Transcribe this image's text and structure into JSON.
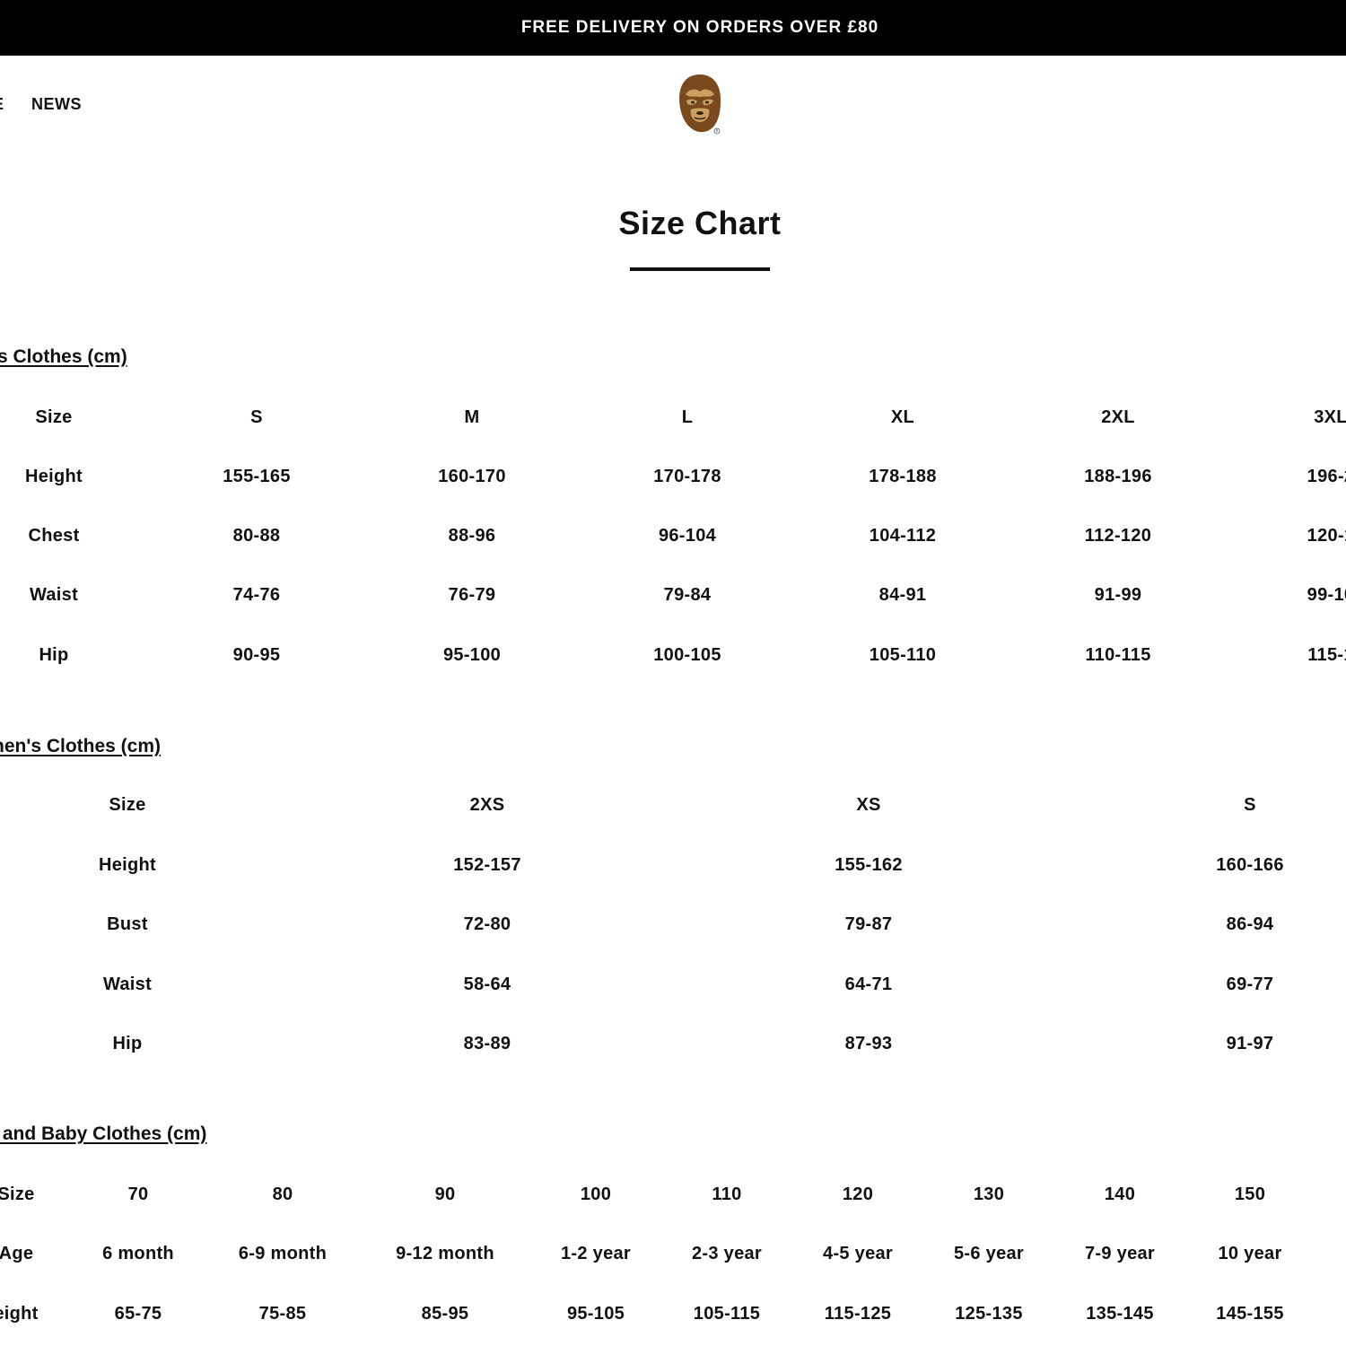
{
  "promo": {
    "text": "FREE DELIVERY ON ORDERS OVER £80"
  },
  "nav": {
    "partial_label": "E",
    "news_label": "NEWS"
  },
  "logo": {
    "name": "ape-head-logo",
    "color": "#7a4a1e"
  },
  "page": {
    "title": "Size Chart"
  },
  "tables": [
    {
      "title": "'s Clothes (cm)",
      "rows": [
        [
          "Size",
          "S",
          "M",
          "L",
          "XL",
          "2XL",
          "3XL"
        ],
        [
          "Height",
          "155-165",
          "160-170",
          "170-178",
          "178-188",
          "188-196",
          "196-2"
        ],
        [
          "Chest",
          "80-88",
          "88-96",
          "96-104",
          "104-112",
          "112-120",
          "120-1"
        ],
        [
          "Waist",
          "74-76",
          "76-79",
          "79-84",
          "84-91",
          "91-99",
          "99-10"
        ],
        [
          "Hip",
          "90-95",
          "95-100",
          "100-105",
          "105-110",
          "110-115",
          "115-1"
        ]
      ]
    },
    {
      "title": "nen's Clothes (cm)",
      "rows": [
        [
          "Size",
          "2XS",
          "XS",
          "S"
        ],
        [
          "Height",
          "152-157",
          "155-162",
          "160-166"
        ],
        [
          "Bust",
          "72-80",
          "79-87",
          "86-94"
        ],
        [
          "Waist",
          "58-64",
          "64-71",
          "69-77"
        ],
        [
          "Hip",
          "83-89",
          "87-93",
          "91-97"
        ]
      ]
    },
    {
      "title": "' and Baby Clothes (cm)",
      "rows": [
        [
          "Size",
          "70",
          "80",
          "90",
          "100",
          "110",
          "120",
          "130",
          "140",
          "150"
        ],
        [
          "Age",
          "6 month",
          "6-9 month",
          "9-12 month",
          "1-2 year",
          "2-3 year",
          "4-5 year",
          "5-6 year",
          "7-9 year",
          "10 year"
        ],
        [
          "eight",
          "65-75",
          "75-85",
          "85-95",
          "95-105",
          "105-115",
          "115-125",
          "125-135",
          "135-145",
          "145-155"
        ]
      ]
    }
  ]
}
